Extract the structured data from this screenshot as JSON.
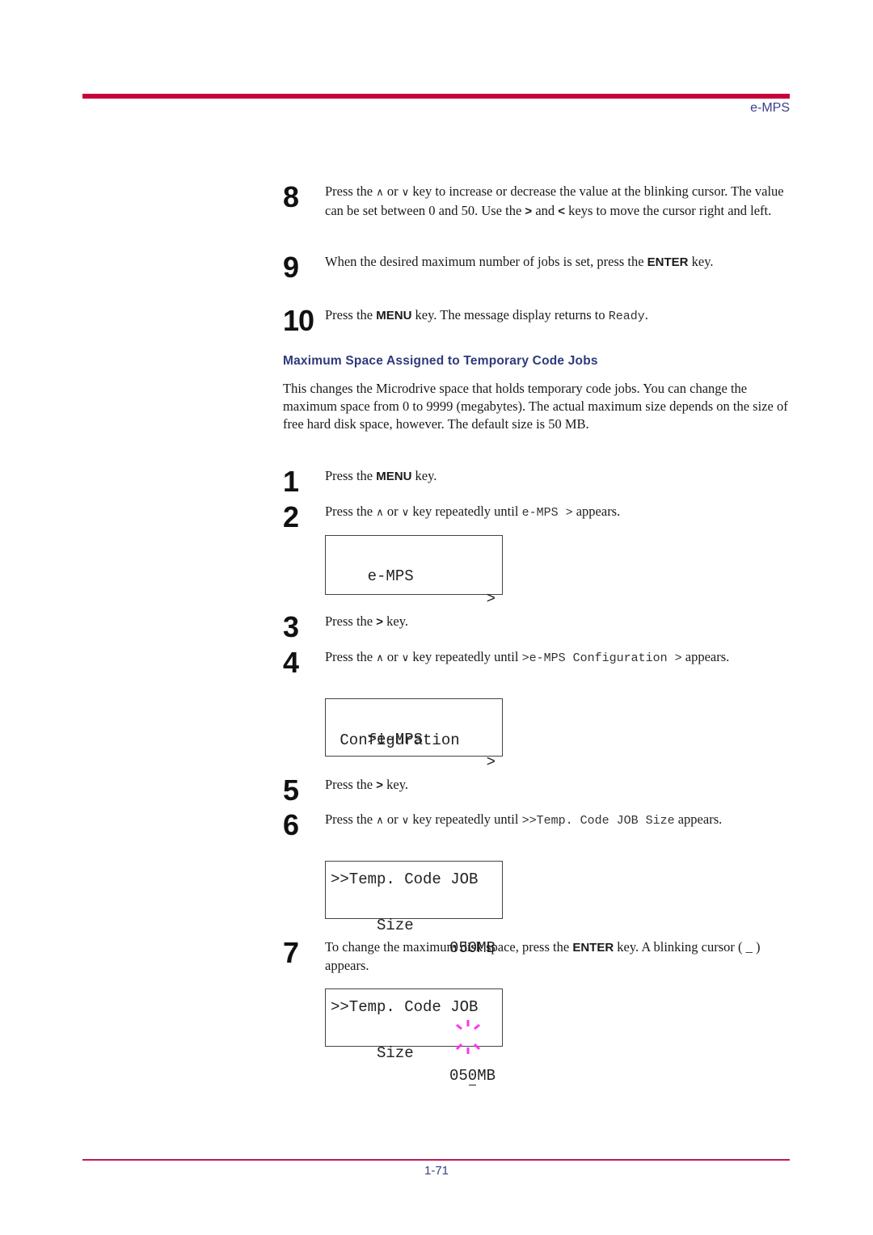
{
  "header": {
    "section_title": "e-MPS"
  },
  "footer": {
    "page_number": "1-71"
  },
  "icons": {
    "up": "∧",
    "down": "∨",
    "right": ">",
    "left": "<"
  },
  "steps_prev": [
    {
      "num": "8",
      "parts": [
        "Press the ",
        "{up}",
        " or ",
        "{down}",
        " key to increase or decrease the value at the blinking cursor. The value can be set between 0 and 50. Use the ",
        "[>]",
        " and ",
        "[<]",
        " keys to move the cursor right and left."
      ]
    },
    {
      "num": "9",
      "parts": [
        "When the desired maximum number of jobs is set, press the ",
        "[ENTER]",
        " key."
      ]
    },
    {
      "num": "10",
      "parts": [
        "Press the ",
        "[MENU]",
        " key. The message display returns to ",
        "`Ready`",
        "."
      ]
    }
  ],
  "section": {
    "heading": "Maximum Space Assigned to Temporary Code Jobs",
    "intro": "This changes the Microdrive space that holds temporary code jobs. You can change the maximum space from 0 to 9999 (megabytes). The actual maximum size depends on the size of free hard disk space, however. The default size is 50 MB."
  },
  "steps": [
    {
      "num": "1",
      "parts": [
        "Press the ",
        "[MENU]",
        " key."
      ]
    },
    {
      "num": "2",
      "parts": [
        "Press the ",
        "{up}",
        " or ",
        "{down}",
        " key repeatedly until ",
        "`e-MPS  >`",
        " appears."
      ]
    },
    {
      "num": "3",
      "parts": [
        "Press the ",
        "[>]",
        " key."
      ]
    },
    {
      "num": "4",
      "parts": [
        "Press the ",
        "{up}",
        " or ",
        "{down}",
        " key repeatedly until ",
        "`>e-MPS Configuration >`",
        " appears."
      ]
    },
    {
      "num": "5",
      "parts": [
        "Press the ",
        "[>]",
        " key."
      ]
    },
    {
      "num": "6",
      "parts": [
        "Press the ",
        "{up}",
        " or ",
        "{down}",
        " key repeatedly until ",
        "`>>Temp. Code JOB Size`",
        " appears."
      ]
    },
    {
      "num": "7",
      "parts": [
        "To change the maximum disk space, press the ",
        "[ENTER]",
        " key. A blinking cursor ( _ ) appears."
      ]
    }
  ],
  "displays": [
    {
      "line1": "e-MPS",
      "line1_right": ">",
      "line2": ""
    },
    {
      "line1": ">e-MPS",
      "line1_right": ">",
      "line2": " Configuration"
    },
    {
      "line1": ">>Temp. Code JOB",
      "line1_right": "",
      "line2_left": " Size",
      "line2_right": "050MB"
    },
    {
      "line1": ">>Temp. Code JOB",
      "line1_right": "",
      "line2_left": " Size",
      "line2_value_before": "05",
      "line2_cursor": "0",
      "line2_value_after": "MB"
    }
  ],
  "colors": {
    "accent_rule": "#c8003c",
    "heading_blue": "#2e3a7a",
    "cursor_rays": "#ff33ee"
  }
}
